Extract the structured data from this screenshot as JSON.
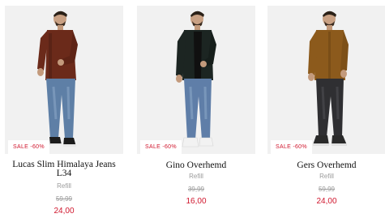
{
  "products": [
    {
      "sale_label": "SALE -60%",
      "name": "Lucas Slim Himalaya Jeans L34",
      "brand": "Refill",
      "old_price": "59,99",
      "new_price": "24,00",
      "colors": {
        "shirt": "#6b2a1a",
        "jeans": "#5e7fa6",
        "shoes": "#1c1c1c"
      }
    },
    {
      "sale_label": "SALE -60%",
      "name": "Gino Overhemd",
      "brand": "Refill",
      "old_price": "39,99",
      "new_price": "16,00",
      "colors": {
        "shirt": "#1c2522",
        "jeans": "#5f7ea8",
        "shoes": "#f2f2f2"
      }
    },
    {
      "sale_label": "SALE -60%",
      "name": "Gers Overhemd",
      "brand": "Refill",
      "old_price": "59,99",
      "new_price": "24,00",
      "colors": {
        "shirt": "#8c5a1c",
        "jeans": "#2f2f32",
        "shoes": "#2a2a2a"
      }
    }
  ],
  "colors": {
    "sale": "#d0162d",
    "muted": "#9a9a9a",
    "image_bg": "#f1f1f1"
  }
}
